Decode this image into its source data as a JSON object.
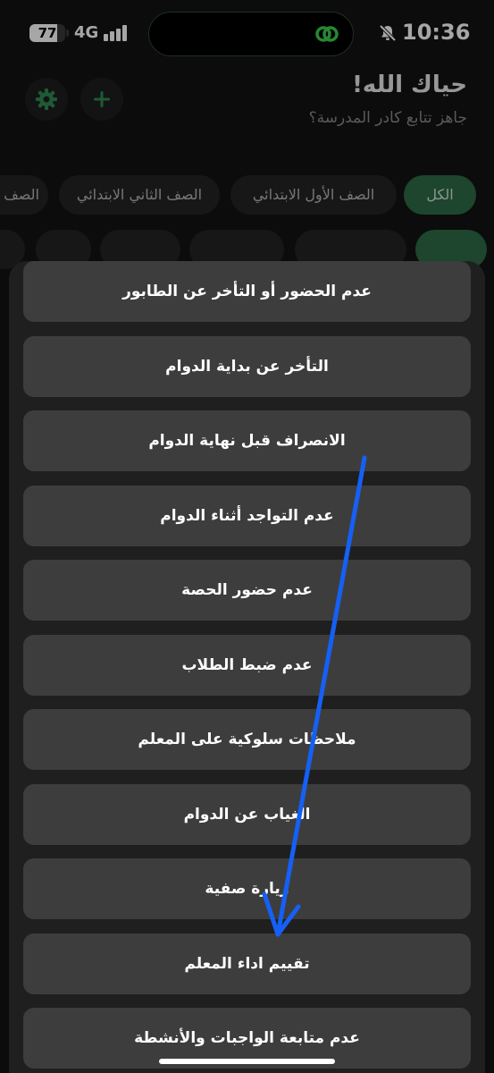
{
  "status_bar": {
    "battery": "77",
    "battery_level": 0.77,
    "network": "4G",
    "time": "10:36"
  },
  "header": {
    "title": "حياك الله!",
    "subtitle": "جاهز تتابع كادر المدرسة؟"
  },
  "filters": {
    "row1": [
      "الكل",
      "الصف الأول الابتدائي",
      "الصف الثاني الابتدائي",
      "الصف"
    ],
    "active": "الكل"
  },
  "sheet": {
    "options": [
      "عدم الحضور أو التأخر عن الطابور",
      "التأخر عن بداية الدوام",
      "الانصراف قبل نهاية الدوام",
      "عدم التواجد أثناء الدوام",
      "عدم حضور الحصة",
      "عدم ضبط الطلاب",
      "ملاحظات سلوكية على المعلم",
      "الغياب عن الدوام",
      "زيارة صفية",
      "تقييم اداء المعلم",
      "عدم متابعة الواجبات والأنشطة"
    ]
  },
  "colors": {
    "accent": "#2e6b47",
    "arrow": "#1560f5",
    "background": "#131313",
    "option_bg": "#3d3d3d"
  },
  "icons": {
    "settings": "gear-icon",
    "add": "plus-icon",
    "island": "link-icon",
    "mute": "bell-slash-icon"
  }
}
